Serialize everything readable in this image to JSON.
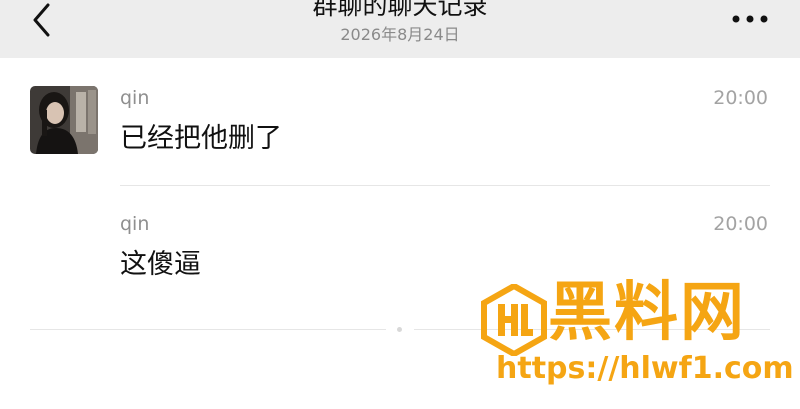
{
  "header": {
    "title": "群聊的聊天记录",
    "date": "2026年8月24日",
    "back_icon": "chevron-left-icon",
    "more_icon": "more-horizontal-icon"
  },
  "messages": [
    {
      "sender": "qin",
      "time": "20:00",
      "text": "已经把他删了",
      "has_avatar": true
    },
    {
      "sender": "qin",
      "time": "20:00",
      "text": "这傻逼",
      "has_avatar": false
    }
  ],
  "watermark": {
    "brand": "黑料网",
    "url": "https://hlwf1.com",
    "color": "#f5a513"
  }
}
